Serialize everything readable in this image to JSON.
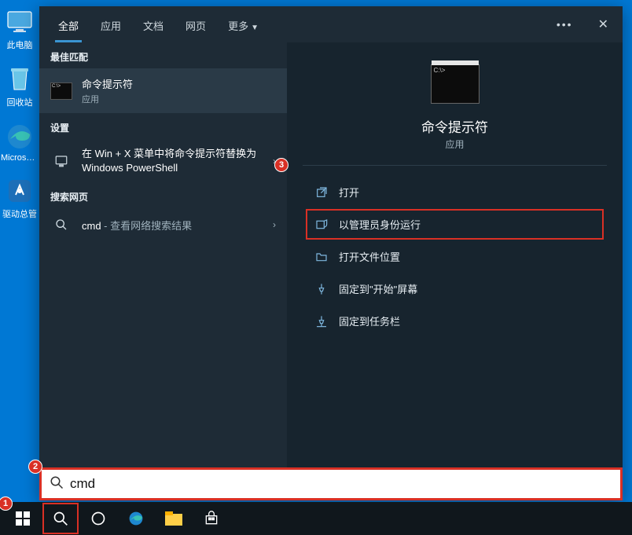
{
  "desktop": {
    "icons": [
      {
        "name": "此电脑",
        "key": "this-pc"
      },
      {
        "name": "回收站",
        "key": "recycle-bin"
      },
      {
        "name": "Microsoft Edge",
        "key": "edge"
      },
      {
        "name": "驱动总管",
        "key": "driver-mgr"
      }
    ]
  },
  "header": {
    "tabs": [
      "全部",
      "应用",
      "文档",
      "网页"
    ],
    "more": "更多",
    "active_index": 0
  },
  "left": {
    "best_match_label": "最佳匹配",
    "best_match": {
      "title": "命令提示符",
      "subtitle": "应用"
    },
    "settings_label": "设置",
    "settings_item": "在 Win + X 菜单中将命令提示符替换为 Windows PowerShell",
    "web_label": "搜索网页",
    "web_item_prefix": "cmd",
    "web_item_suffix": " - 查看网络搜索结果"
  },
  "preview": {
    "title": "命令提示符",
    "subtitle": "应用",
    "actions": [
      {
        "key": "open",
        "label": "打开",
        "icon": "open-icon"
      },
      {
        "key": "run-admin",
        "label": "以管理员身份运行",
        "icon": "shield-icon",
        "highlighted": true
      },
      {
        "key": "open-location",
        "label": "打开文件位置",
        "icon": "folder-icon"
      },
      {
        "key": "pin-start",
        "label": "固定到\"开始\"屏幕",
        "icon": "pin-icon"
      },
      {
        "key": "pin-taskbar",
        "label": "固定到任务栏",
        "icon": "pin-taskbar-icon"
      }
    ]
  },
  "search": {
    "value": "cmd",
    "placeholder": ""
  },
  "annotations": {
    "b1": "1",
    "b2": "2",
    "b3": "3"
  }
}
